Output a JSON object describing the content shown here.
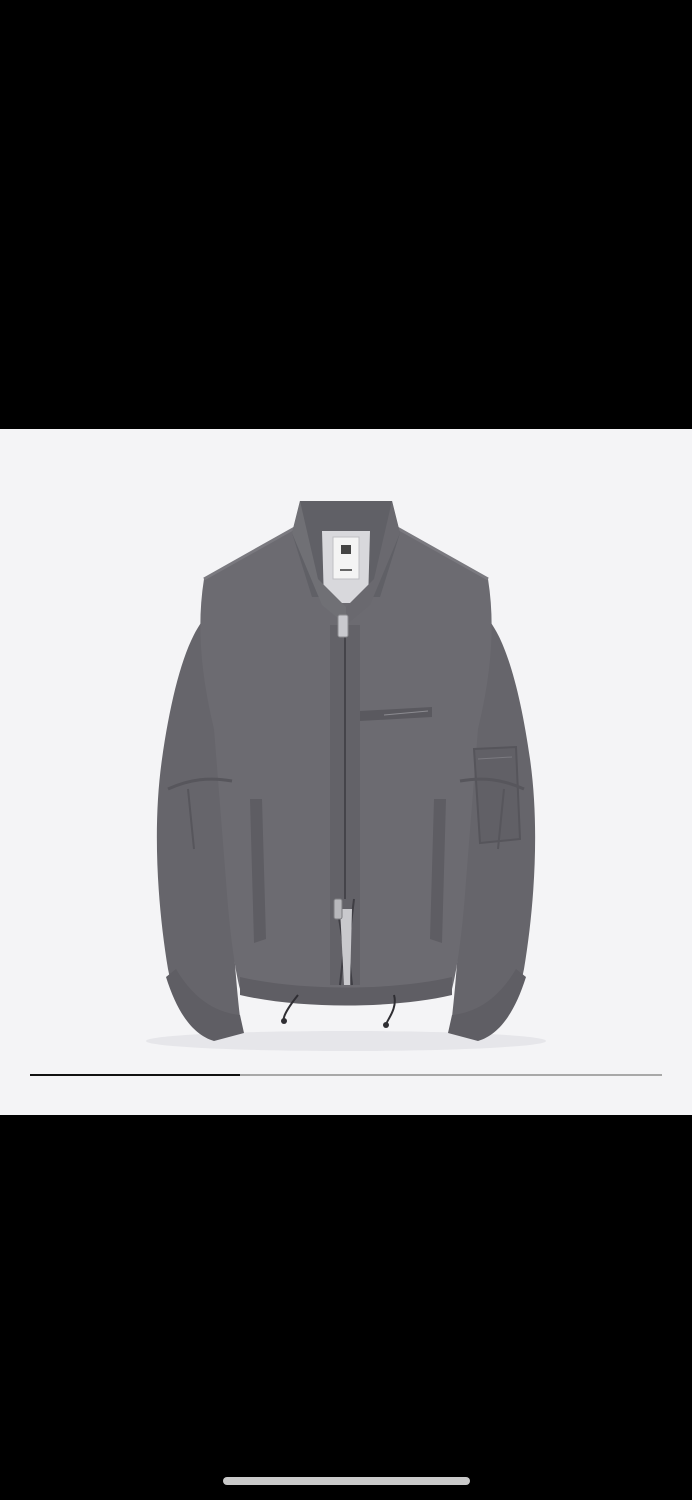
{
  "viewer": {
    "background": "#000000"
  },
  "product_image": {
    "subject": "jacket-image",
    "background": "#f4f4f6",
    "garment_color": "#6b6a70"
  },
  "carousel": {
    "progress_fraction": 0.333,
    "track_color": "#a8a8a8",
    "fill_color": "#111111"
  },
  "home_indicator": {
    "color": "#c9c9c9"
  }
}
